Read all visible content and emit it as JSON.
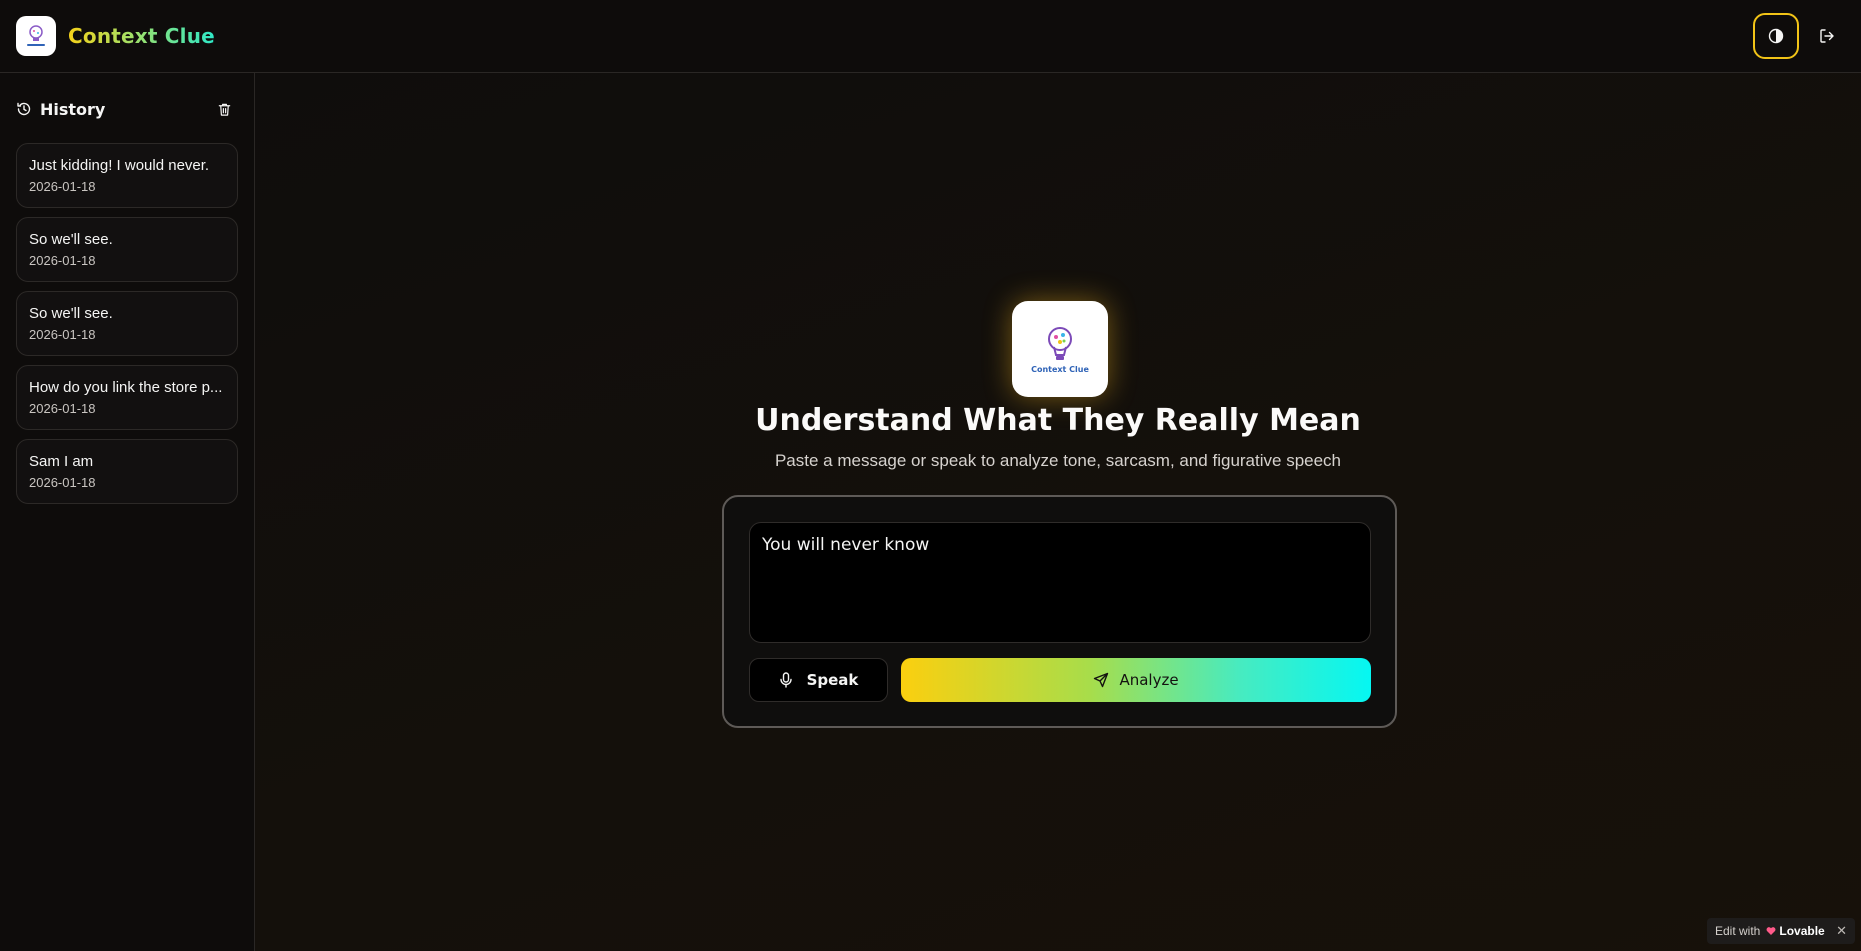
{
  "header": {
    "app_name": "Context Clue",
    "logo_text": "Context Clue",
    "icons": {
      "theme": "contrast-icon",
      "logout": "logout-icon"
    },
    "colors": {
      "brand_gradient": [
        "#f6d21a",
        "#2ee8c8"
      ],
      "theme_border": "#f2c417"
    }
  },
  "sidebar": {
    "title": "History",
    "icons": {
      "title": "history-icon",
      "clear": "trash-icon"
    },
    "items": [
      {
        "text": "Just kidding! I would never.",
        "date": "2026-01-18"
      },
      {
        "text": "So we'll see.",
        "date": "2026-01-18"
      },
      {
        "text": "So we'll see.",
        "date": "2026-01-18"
      },
      {
        "text": "How do you link the store p...",
        "date": "2026-01-18"
      },
      {
        "text": "Sam I am",
        "date": "2026-01-18"
      }
    ]
  },
  "main": {
    "logo_text": "Context Clue",
    "title": "Understand What They Really Mean",
    "subtitle": "Paste a message or speak to analyze tone, sarcasm, and figurative speech",
    "input": {
      "value": "You will never know"
    },
    "speak_label": "Speak",
    "analyze_label": "Analyze",
    "icons": {
      "speak": "microphone-icon",
      "analyze": "send-icon"
    },
    "colors": {
      "analyze_gradient": [
        "#fbcf0f",
        "#05f7f2"
      ]
    }
  },
  "badge": {
    "edit_label": "Edit with",
    "brand_label": "Lovable",
    "close_label": "✕"
  }
}
